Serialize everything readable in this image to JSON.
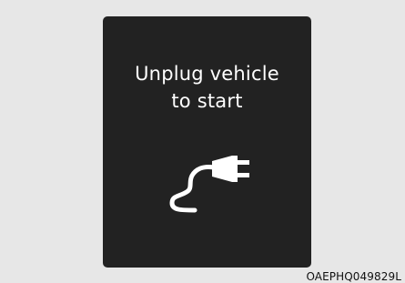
{
  "display": {
    "line1": "Unplug vehicle",
    "line2": "to start",
    "icon": "charging-plug-icon"
  },
  "image_code": "OAEPHQ049829L",
  "colors": {
    "background": "#e7e7e7",
    "panel": "#222222",
    "text": "#ffffff"
  }
}
